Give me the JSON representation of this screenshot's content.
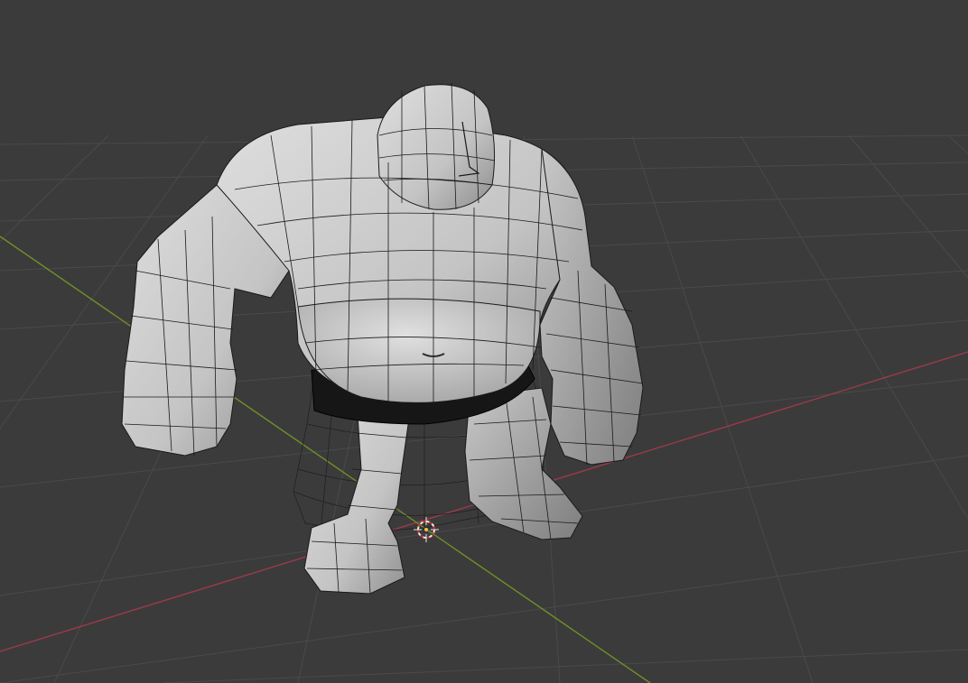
{
  "viewport": {
    "mode": "3D viewport",
    "shading": "solid-with-wireframe-overlay",
    "object": "troll-character-mesh"
  },
  "colors": {
    "background": "#3b3b3b",
    "grid_line": "#4a4a4a",
    "x_axis": "#9c3a48",
    "y_axis": "#6f8f2a",
    "mesh_fill": "#c9c9c9",
    "mesh_shadow": "#9a9a9a",
    "wireframe": "#1a1a1a",
    "shorts": "#161616",
    "cursor_ring": "#e8e8e8",
    "cursor_accent": "#d03030"
  },
  "icons": {
    "cursor": "3d-cursor-icon"
  }
}
